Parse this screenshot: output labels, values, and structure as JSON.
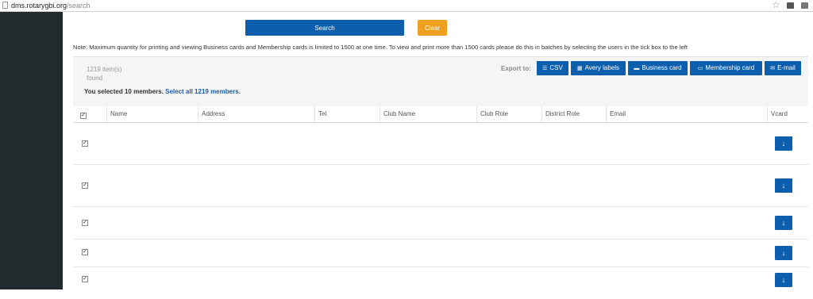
{
  "browser": {
    "url_host": "dms.rotarygbi.org",
    "url_path": "/search"
  },
  "search": {
    "search_label": "Search",
    "clear_label": "Clear"
  },
  "note": "Note: Maximum quantity for printing and viewing Business cards and Membership cards is limited to 1500 at one time. To view and print more than 1500 cards please do this in batches by selecting the users in the tick box to the left",
  "results": {
    "count_line1": "1219 item(s)",
    "count_line2": "found",
    "selected_text": "You selected 10 members.",
    "select_all_link": "Select all 1219 members."
  },
  "export": {
    "label": "Export to:",
    "buttons": [
      {
        "label": "CSV",
        "icon": "list-icon"
      },
      {
        "label": "Avery labels",
        "icon": "grid-icon"
      },
      {
        "label": "Business card",
        "icon": "briefcase-icon"
      },
      {
        "label": "Membership card",
        "icon": "id-card-icon"
      },
      {
        "label": "E-mail",
        "icon": "envelope-icon"
      }
    ]
  },
  "table": {
    "columns": [
      "Name",
      "Address",
      "Tel",
      "Club Name",
      "Club Role",
      "District Role",
      "Email",
      "Vcard"
    ],
    "rows_checked": [
      true,
      true,
      true,
      true,
      true
    ]
  },
  "colors": {
    "primary": "#0d5fae",
    "clear": "#f0a020",
    "sidebar": "#1f2b2d"
  }
}
